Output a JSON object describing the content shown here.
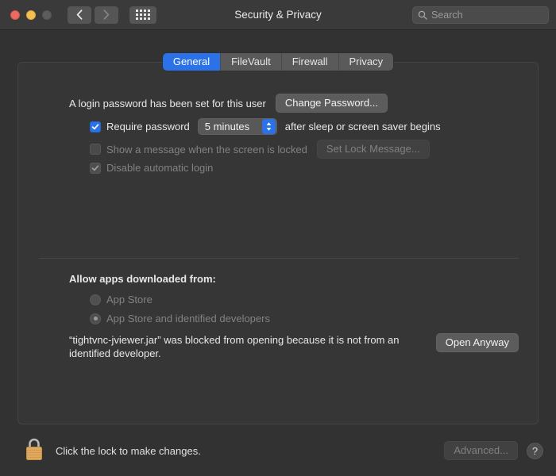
{
  "titlebar": {
    "title": "Security & Privacy",
    "back_icon": "chevron-left-icon",
    "forward_icon": "chevron-right-icon",
    "grid_icon": "show-all-grid-icon",
    "search": {
      "icon": "search-icon",
      "placeholder": "Search",
      "value": ""
    },
    "traffic_lights": {
      "close": "close-button",
      "minimize": "minimize-button",
      "zoom": "zoom-button"
    }
  },
  "tabs": [
    {
      "label": "General",
      "active": true
    },
    {
      "label": "FileVault",
      "active": false
    },
    {
      "label": "Firewall",
      "active": false
    },
    {
      "label": "Privacy",
      "active": false
    }
  ],
  "general": {
    "login_password_text": "A login password has been set for this user",
    "change_password_label": "Change Password...",
    "require_password": {
      "label": "Require password",
      "checked": true,
      "delay_value": "5 minutes",
      "suffix": "after sleep or screen saver begins"
    },
    "show_message": {
      "label": "Show a message when the screen is locked",
      "checked": false,
      "button_label": "Set Lock Message..."
    },
    "disable_auto_login": {
      "label": "Disable automatic login",
      "checked": true
    }
  },
  "gatekeeper": {
    "heading": "Allow apps downloaded from:",
    "options": [
      {
        "label": "App Store",
        "selected": false
      },
      {
        "label": "App Store and identified developers",
        "selected": true
      }
    ],
    "blocked_message": "“tightvnc-jviewer.jar” was blocked from opening because it is not from an identified developer.",
    "open_anyway_label": "Open Anyway"
  },
  "footer": {
    "lock_icon": "closed-padlock-icon",
    "lock_caption": "Click the lock to make changes.",
    "advanced_label": "Advanced...",
    "help_label": "?"
  },
  "colors": {
    "accent": "#2b72e8",
    "window_bg": "#323232",
    "panel_bg": "#363636",
    "lock_gold": "#e8b66a"
  }
}
